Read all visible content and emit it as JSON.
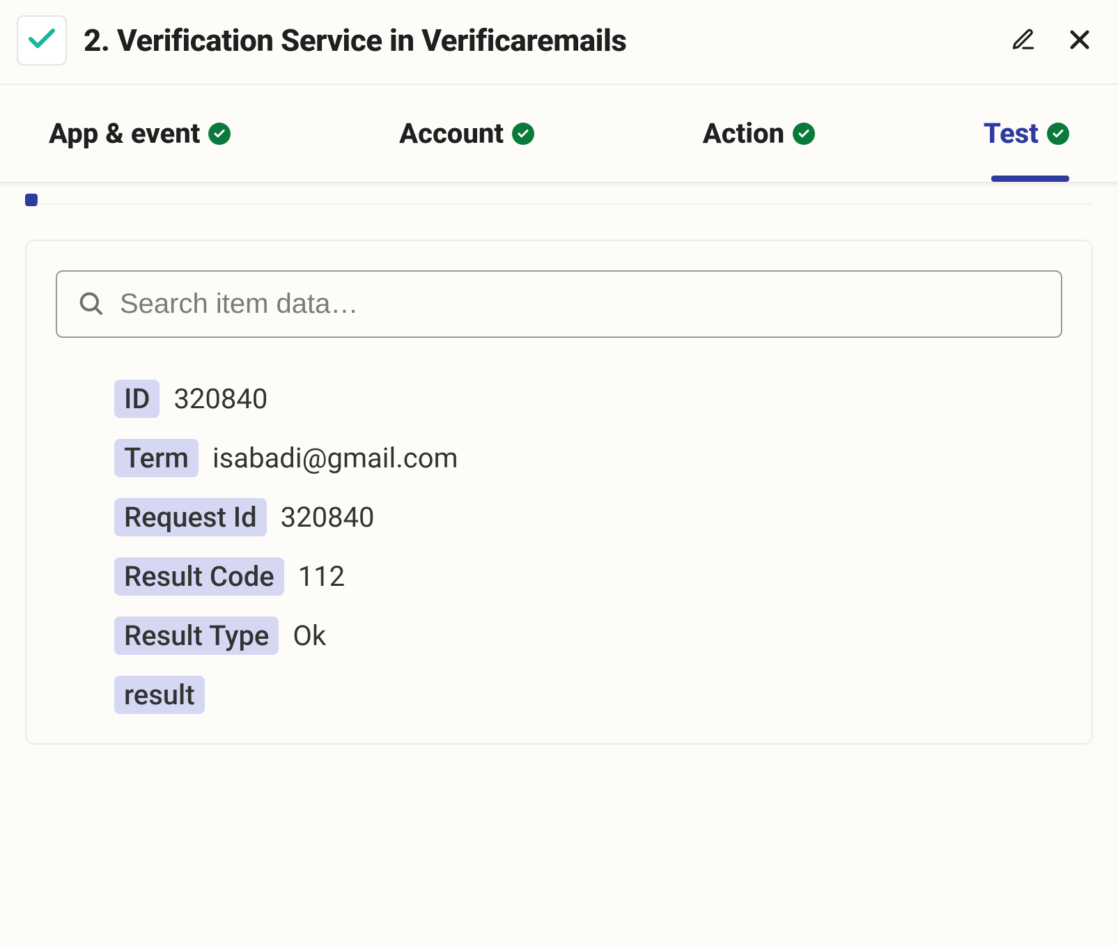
{
  "header": {
    "title": "2. Verification Service in Verificaremails"
  },
  "tabs": [
    {
      "label": "App & event",
      "active": false
    },
    {
      "label": "Account",
      "active": false
    },
    {
      "label": "Action",
      "active": false
    },
    {
      "label": "Test",
      "active": true
    }
  ],
  "search": {
    "placeholder": "Search item data…",
    "value": ""
  },
  "result_rows": [
    {
      "key": "ID",
      "value": "320840"
    },
    {
      "key": "Term",
      "value": "isabadi@gmail.com"
    },
    {
      "key": "Request Id",
      "value": "320840"
    },
    {
      "key": "Result Code",
      "value": "112"
    },
    {
      "key": "Result Type",
      "value": "Ok"
    },
    {
      "key": "result",
      "value": ""
    }
  ]
}
